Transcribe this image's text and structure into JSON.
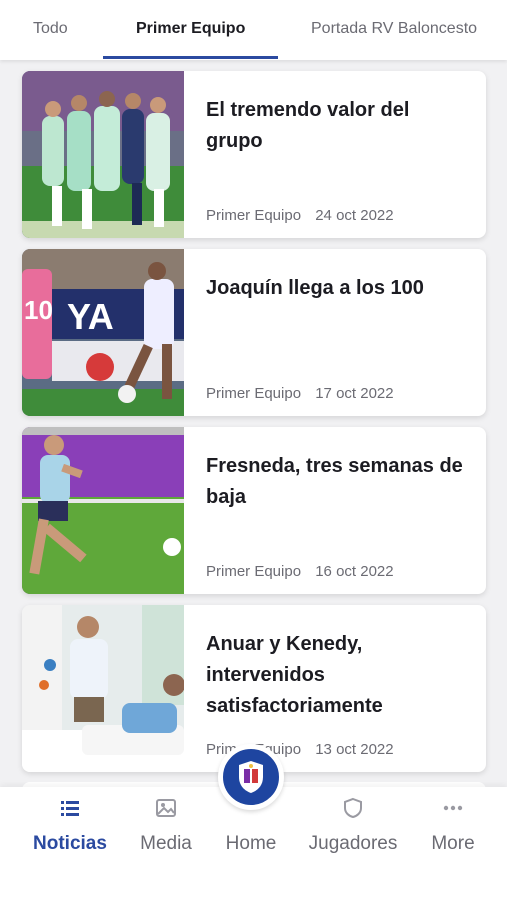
{
  "tabs": [
    {
      "label": "Todo",
      "active": false
    },
    {
      "label": "Primer Equipo",
      "active": true
    },
    {
      "label": "Portada RV Baloncesto",
      "active": false
    }
  ],
  "articles": [
    {
      "title": "El tremendo valor del grupo",
      "category": "Primer Equipo",
      "date": "24 oct 2022",
      "image": "team-celebration-photo"
    },
    {
      "title": "Joaquín llega a los 100",
      "category": "Primer Equipo",
      "date": "17 oct 2022",
      "image": "player-kicking-ball-photo"
    },
    {
      "title": "Fresneda, tres semanas de baja",
      "category": "Primer Equipo",
      "date": "16 oct 2022",
      "image": "player-training-photo"
    },
    {
      "title": "Anuar y Kenedy, intervenidos satisfactoriamente",
      "category": "Primer Equipo",
      "date": "13 oct 2022",
      "image": "hospital-patient-photo"
    }
  ],
  "bottom_nav": [
    {
      "label": "Noticias",
      "icon": "list-icon",
      "active": true
    },
    {
      "label": "Media",
      "icon": "image-icon",
      "active": false
    },
    {
      "label": "Home",
      "icon": "club-crest-icon",
      "active": false
    },
    {
      "label": "Jugadores",
      "icon": "shield-icon",
      "active": false
    },
    {
      "label": "More",
      "icon": "more-dots-icon",
      "active": false
    }
  ],
  "colors": {
    "accent": "#2b4aa0",
    "home_button": "#1e45a0",
    "text": "#1c1c22",
    "muted": "#6b6b73"
  }
}
